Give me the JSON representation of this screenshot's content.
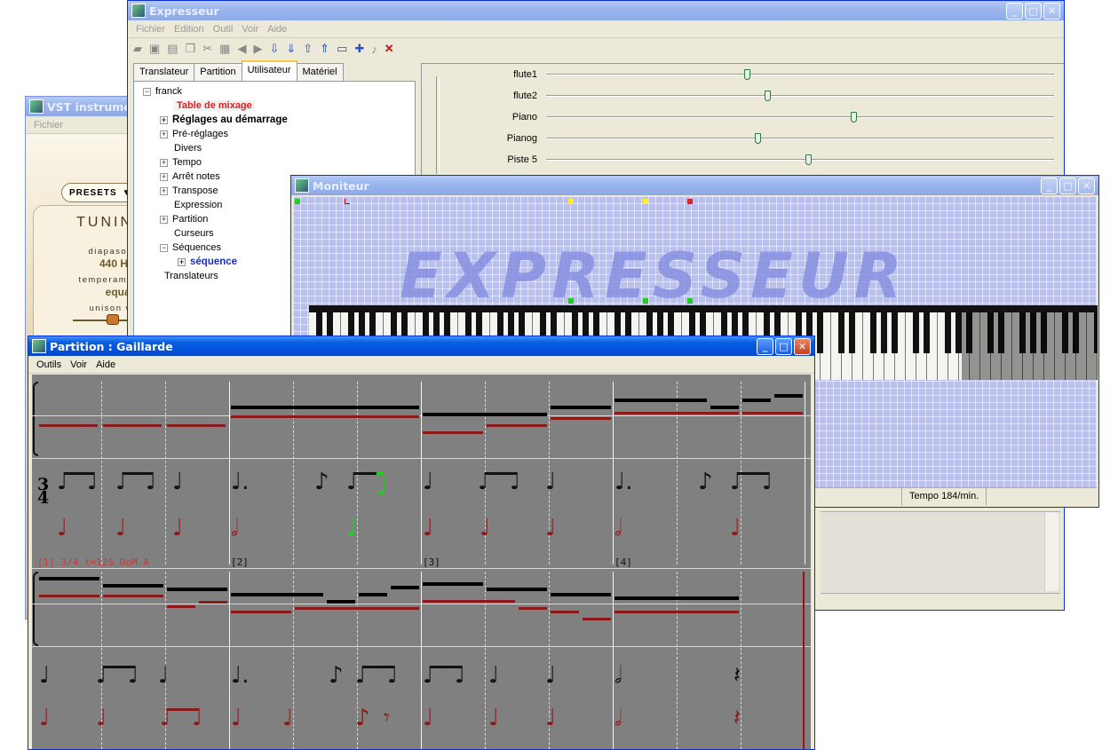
{
  "expresseur": {
    "title": "Expresseur",
    "menu": [
      "Fichier",
      "Edition",
      "Outil",
      "Voir",
      "Aide"
    ],
    "tabs": [
      "Translateur",
      "Partition",
      "Utilisateur",
      "Matériel"
    ],
    "tree": {
      "root": "franck",
      "items": [
        "Table de mixage",
        "Réglages au démarrage",
        "Pré-réglages",
        "Divers",
        "Tempo",
        "Arrêt notes",
        "Transpose",
        "Expression",
        "Partition",
        "Curseurs",
        "Séquences",
        "séquence",
        "Translateurs"
      ]
    },
    "mixer": [
      {
        "label": "flute1",
        "level": 0.39
      },
      {
        "label": "flute2",
        "level": 0.43
      },
      {
        "label": "Piano",
        "level": 0.6
      },
      {
        "label": "Pianog",
        "level": 0.41
      },
      {
        "label": "Piste 5",
        "level": 0.51
      }
    ]
  },
  "vst": {
    "title": "VST instrument",
    "menu": "Fichier",
    "presets": "PRESETS",
    "tuning": "TUNIN",
    "diapason_label": "diapason",
    "diapason_value": "440 Hz",
    "temperament_label": "temperame",
    "temperament_value": "equal",
    "unison_label": "unison w"
  },
  "moniteur": {
    "title": "Moniteur",
    "watermark": "EXPRESSEUR",
    "tempo": "Tempo 184/min."
  },
  "partition": {
    "title": "Partition : Gaillarde",
    "menu": [
      "Outils",
      "Voir",
      "Aide"
    ],
    "timesig_top": "3",
    "timesig_bottom": "4",
    "measure1_info": "[1] 3/4 t=125 DoM  A",
    "measures": [
      "[2]",
      "[3]",
      "[4]"
    ]
  },
  "colors": {
    "xp_blue": "#0052dd",
    "score_bg": "#808080",
    "note_red": "#8b1a1a",
    "note_green": "#22cc22"
  }
}
